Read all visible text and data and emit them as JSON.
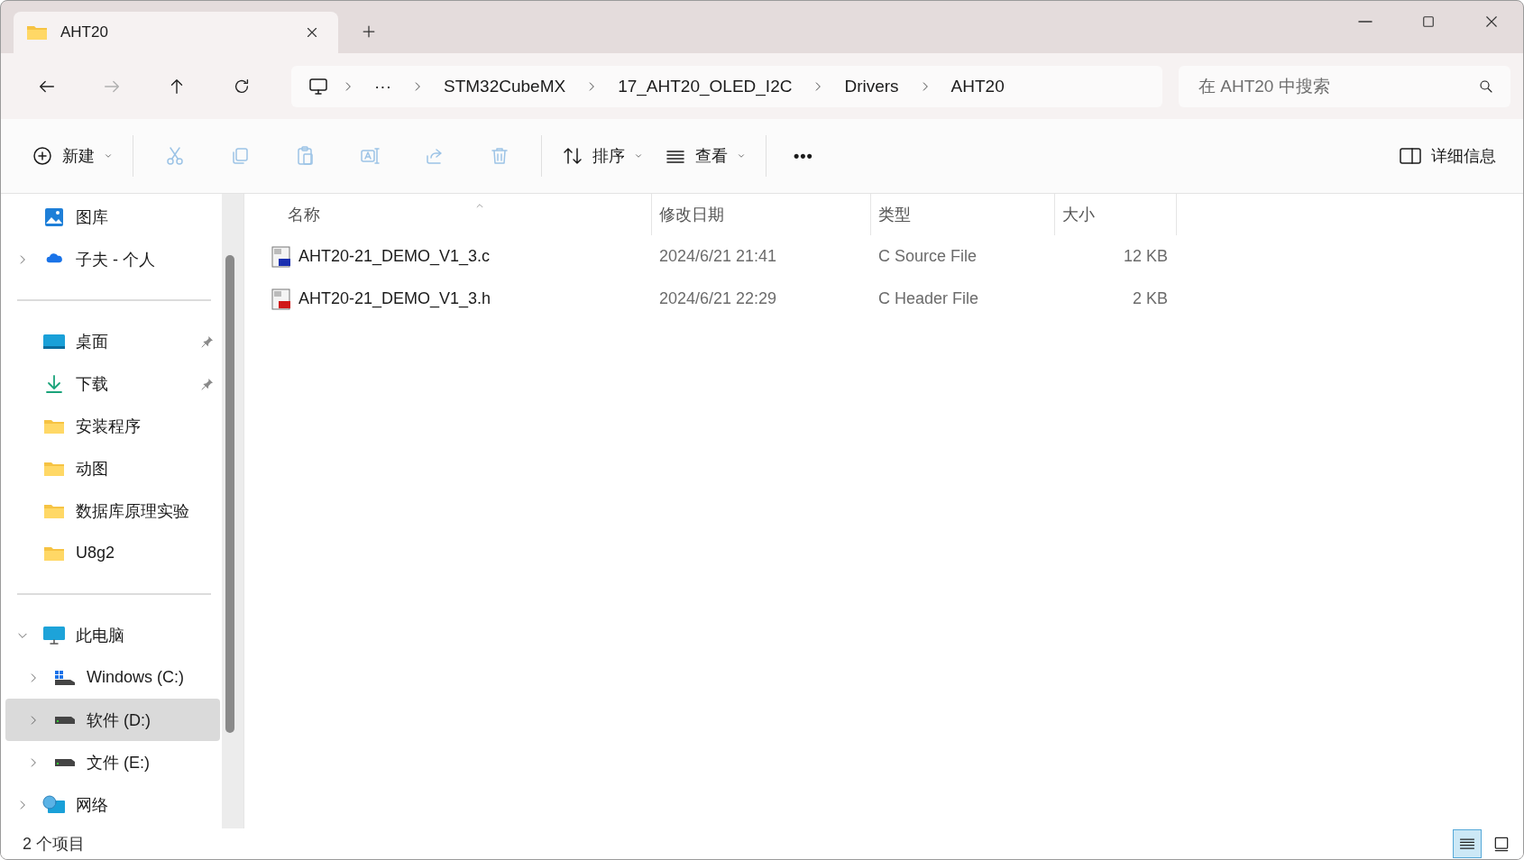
{
  "tabs": [
    {
      "title": "AHT20",
      "selected": true
    }
  ],
  "nav": [
    {
      "kind": "back",
      "disabled": false
    },
    {
      "kind": "forward",
      "disabled": true
    },
    {
      "kind": "up",
      "disabled": false
    },
    {
      "kind": "refresh",
      "disabled": false
    }
  ],
  "breadcrumb": [
    "···",
    "STM32CubeMX",
    "17_AHT20_OLED_I2C",
    "Drivers",
    "AHT20"
  ],
  "search": {
    "placeholder": "在 AHT20 中搜索"
  },
  "toolbar": [
    {
      "kind": "new",
      "label": "新建",
      "disabled": false
    },
    {
      "kind": "cut",
      "disabled": true
    },
    {
      "kind": "copy",
      "disabled": true
    },
    {
      "kind": "paste",
      "disabled": true
    },
    {
      "kind": "rename",
      "disabled": true
    },
    {
      "kind": "share",
      "disabled": true
    },
    {
      "kind": "delete",
      "disabled": true
    },
    {
      "kind": "sort",
      "label": "排序",
      "disabled": false
    },
    {
      "kind": "view",
      "label": "查看",
      "disabled": false
    },
    {
      "kind": "more",
      "label": "•••",
      "disabled": false
    }
  ],
  "details_button": "详细信息",
  "sidebar": {
    "sections": [
      [
        {
          "label": "图库",
          "kind": "gallery",
          "pinned": false,
          "selected": false
        },
        {
          "label": "子夫 - 个人",
          "kind": "cloud",
          "pinned": false,
          "selected": false,
          "expanded": false
        }
      ],
      [
        {
          "label": "桌面",
          "kind": "desktop",
          "pinned": true,
          "selected": false
        },
        {
          "label": "下载",
          "kind": "download",
          "pinned": true,
          "selected": false
        },
        {
          "label": "安装程序",
          "kind": "folder",
          "pinned": false,
          "selected": false
        },
        {
          "label": "动图",
          "kind": "folder",
          "pinned": false,
          "selected": false
        },
        {
          "label": "数据库原理实验",
          "kind": "folder",
          "pinned": false,
          "selected": false
        },
        {
          "label": "U8g2",
          "kind": "folder",
          "pinned": false,
          "selected": false
        }
      ],
      [
        {
          "label": "此电脑",
          "kind": "pc",
          "pinned": false,
          "selected": false,
          "expanded": true,
          "children": [
            {
              "label": "Windows (C:)",
              "kind": "windrive",
              "pinned": false,
              "selected": false,
              "expanded": false
            },
            {
              "label": "软件 (D:)",
              "kind": "drive",
              "pinned": false,
              "selected": true,
              "expanded": false
            },
            {
              "label": "文件 (E:)",
              "kind": "drive",
              "pinned": false,
              "selected": false,
              "expanded": false
            }
          ]
        },
        {
          "label": "网络",
          "kind": "network",
          "pinned": false,
          "selected": false,
          "expanded": false
        }
      ]
    ]
  },
  "table": {
    "columns": [
      "名称",
      "修改日期",
      "类型",
      "大小"
    ],
    "rows": [
      {
        "kind": "c",
        "name": "AHT20-21_DEMO_V1_3.c",
        "modified": "2024/6/21 21:41",
        "type": "C Source File",
        "size": "12 KB"
      },
      {
        "kind": "h",
        "name": "AHT20-21_DEMO_V1_3.h",
        "modified": "2024/6/21 22:29",
        "type": "C Header File",
        "size": "2 KB"
      }
    ]
  },
  "status_bar": {
    "count": "2 个项目",
    "views": [
      {
        "kind": "details",
        "selected": true
      },
      {
        "kind": "tiles",
        "selected": false
      }
    ]
  }
}
